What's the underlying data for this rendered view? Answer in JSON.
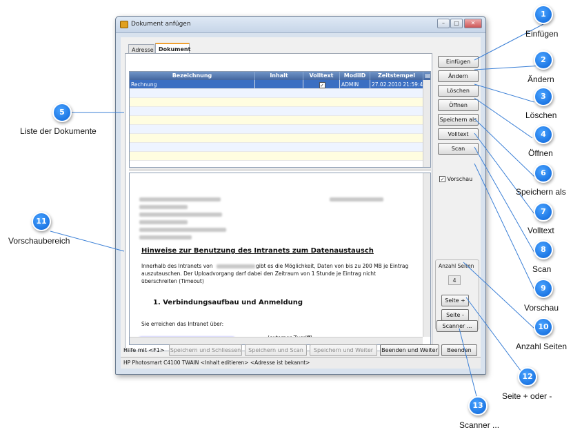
{
  "window": {
    "title": "Dokument anfügen",
    "controls": {
      "minimize": "–",
      "maximize": "□",
      "close": "✕"
    }
  },
  "tabs": [
    {
      "label": "Adresse",
      "active": false
    },
    {
      "label": "Dokument",
      "active": true
    }
  ],
  "grid": {
    "columns": [
      "Bezeichnung",
      "Inhalt",
      "Volltext",
      "ModiID",
      "Zeitstempel"
    ],
    "rows": [
      {
        "bezeichnung": "Rechnung",
        "inhalt": "",
        "volltext": true,
        "modiid": "ADMIN",
        "zeitstempel": "27.02.2010 21:59:47"
      }
    ]
  },
  "preview": {
    "heading": "Hinweise zur Benutzung des Intranets zum Datenaustausch",
    "para_line1_pre": "Innerhalb des Intranets von",
    "para_line1_post": "gibt es die Möglichkeit, Daten von  bis zu 200 MB je Eintrag",
    "para_line2": "auszutauschen.  Der Uploadvorgang darf dabei den Zeitraum von 1 Stunde je Eintrag nicht",
    "para_line3": "überschreiten (Timeout)",
    "section": "1.  Verbindungsaufbau und Anmeldung",
    "access_line": "Sie erreichen das Intranet über:",
    "external": "(externer Zugriff)"
  },
  "buttons": {
    "einfuegen": "Einfügen",
    "aendern": "Ändern",
    "loeschen": "Löschen",
    "oeffnen": "Öffnen",
    "speichern_als": "Speichern als",
    "volltext": "Volltext",
    "scan": "Scan",
    "vorschau": "Vorschau",
    "anzahl_seiten": "Anzahl Seiten",
    "seiten_wert": "4",
    "seite_plus": "Seite +",
    "seite_minus": "Seite -",
    "scanner": "Scanner ..."
  },
  "footer": {
    "hilfe": "Hilfe mit <F1>",
    "speichern_schliessen": "Speichern und Schliessen",
    "speichern_scan": "Speichern und Scan",
    "speichern_weiter": "Speichern und Weiter",
    "beenden_weiter": "Beenden und Weiter",
    "beenden": "Beenden",
    "status": "HP Photosmart C4100 TWAIN <Inhalt editieren> <Adresse ist bekannt>"
  },
  "callouts": [
    {
      "n": "1",
      "label": "Einfügen"
    },
    {
      "n": "2",
      "label": "Ändern"
    },
    {
      "n": "3",
      "label": "Löschen"
    },
    {
      "n": "4",
      "label": "Öffnen"
    },
    {
      "n": "5",
      "label": "Liste der Dokumente"
    },
    {
      "n": "6",
      "label": "Speichern als"
    },
    {
      "n": "7",
      "label": "Volltext"
    },
    {
      "n": "8",
      "label": "Scan"
    },
    {
      "n": "9",
      "label": "Vorschau"
    },
    {
      "n": "10",
      "label": "Anzahl Seiten"
    },
    {
      "n": "11",
      "label": "Vorschaubereich"
    },
    {
      "n": "12",
      "label": "Seite + oder -"
    },
    {
      "n": "13",
      "label": "Scanner ..."
    }
  ],
  "colors": {
    "accent": "#0a64d8",
    "selection": "#3b6fc2",
    "header": "#44679f"
  }
}
